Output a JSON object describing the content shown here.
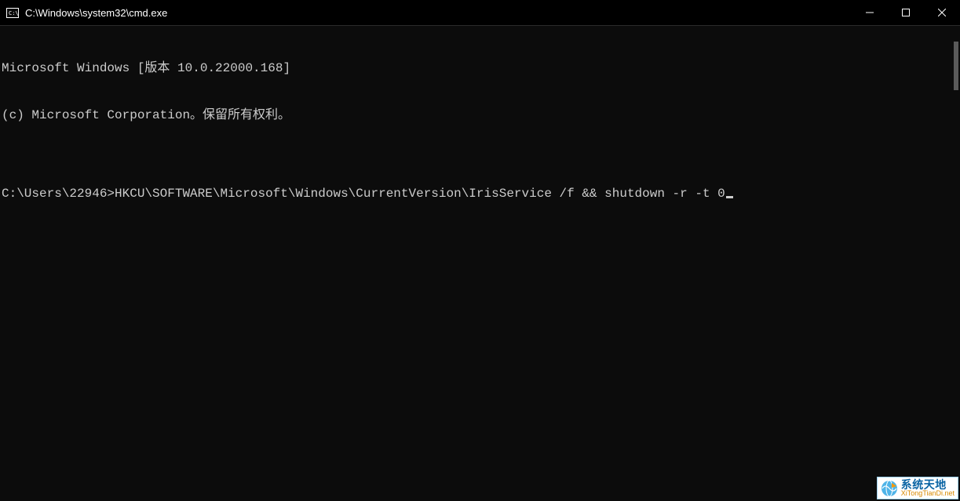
{
  "titlebar": {
    "title": "C:\\Windows\\system32\\cmd.exe"
  },
  "terminal": {
    "line1": "Microsoft Windows [版本 10.0.22000.168]",
    "line2": "(c) Microsoft Corporation。保留所有权利。",
    "blank": "",
    "prompt": "C:\\Users\\22946>",
    "command": "HKCU\\SOFTWARE\\Microsoft\\Windows\\CurrentVersion\\IrisService /f && shutdown -r -t 0"
  },
  "watermark": {
    "brand": "系统天地",
    "url": "XiTongTianDi.net"
  }
}
